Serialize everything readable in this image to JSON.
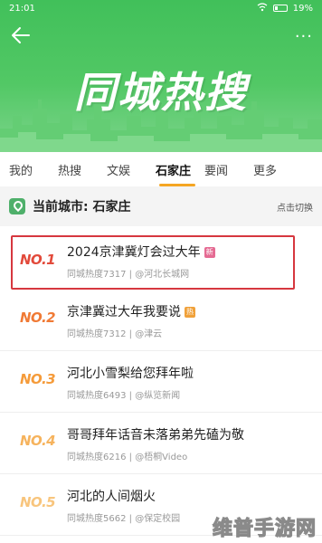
{
  "status": {
    "time": "21:01",
    "battery": "19%"
  },
  "header": {
    "title": "同城热搜",
    "more": "···"
  },
  "tabs": [
    {
      "label": "我的"
    },
    {
      "label": "热搜"
    },
    {
      "label": "文娱"
    },
    {
      "label": "石家庄",
      "active": true
    },
    {
      "label": "要闻"
    },
    {
      "label": "更多"
    }
  ],
  "city": {
    "label": "当前城市: 石家庄",
    "switch": "点击切换"
  },
  "items": [
    {
      "rank": "NO.1",
      "title": "2024京津冀灯会过大年",
      "badge": "新",
      "heat": "同城热度7317",
      "source": "@河北长城网"
    },
    {
      "rank": "NO.2",
      "title": "京津冀过大年我要说",
      "badge": "热",
      "heat": "同城热度7312",
      "source": "@津云"
    },
    {
      "rank": "NO.3",
      "title": "河北小雪梨给您拜年啦",
      "badge": "",
      "heat": "同城热度6493",
      "source": "@纵览新闻"
    },
    {
      "rank": "NO.4",
      "title": "哥哥拜年话音未落弟弟先磕为敬",
      "badge": "",
      "heat": "同城热度6216",
      "source": "@梧桐Video"
    },
    {
      "rank": "NO.5",
      "title": "河北的人间烟火",
      "badge": "",
      "heat": "同城热度5662",
      "source": "@保定校园"
    }
  ],
  "watermark": "维普手游网"
}
